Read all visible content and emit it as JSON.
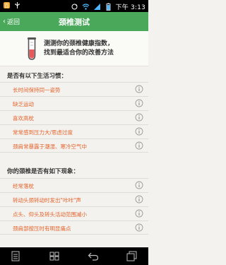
{
  "status_bar": {
    "time": "下午 3:13",
    "icons": [
      "app-notification-icon",
      "usb-icon",
      "sync-icon",
      "wifi-icon",
      "cellular-signal-icon",
      "battery-icon"
    ]
  },
  "header": {
    "back_label": "返回",
    "title": "颈椎测试"
  },
  "banner": {
    "line1": "测测你的颈椎健康指数，",
    "line2": "找到最适合你的改善方法"
  },
  "section_lifestyle": {
    "title": "是否有以下生活习惯：",
    "items": [
      {
        "label": "长时间保持同一姿势"
      },
      {
        "label": "缺乏运动"
      },
      {
        "label": "喜欢高枕"
      },
      {
        "label": "常常感到压力大/思虑过度"
      },
      {
        "label": "颈肩常暴露于潮湿、寒冷空气中"
      }
    ]
  },
  "section_symptoms": {
    "title": "你的颈椎是否有如下现象：",
    "items": [
      {
        "label": "经常落枕"
      },
      {
        "label": "转动头颈转动时发出\"咔咔\"声"
      },
      {
        "label": "点头、仰头及转头活动范围减小"
      },
      {
        "label": "颈肩部按压时有明显痛点"
      }
    ]
  },
  "colors": {
    "header_green": "#4aa85b",
    "item_orange": "#e4622a",
    "background": "#f3f2ee"
  }
}
